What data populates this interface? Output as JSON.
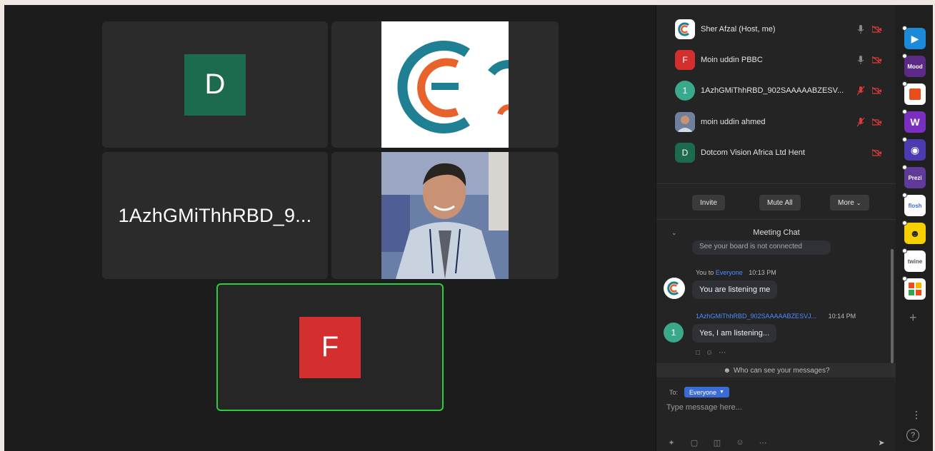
{
  "tiles": {
    "d_initial": "D",
    "tile3_name": "1AzhGMiThhRBD_9...",
    "f_initial": "F"
  },
  "participants": [
    {
      "name": "Sher Afzal (Host, me)",
      "initial": "",
      "color": "#ffffff"
    },
    {
      "name": "Moin uddin PBBC",
      "initial": "F",
      "color": "#d32f2f"
    },
    {
      "name": "1AzhGMiThhRBD_902SAAAAABZESV...",
      "initial": "1",
      "color": "#3aa88a"
    },
    {
      "name": "moin uddin ahmed",
      "initial": "",
      "color": "#888888"
    },
    {
      "name": "Dotcom Vision Africa Ltd Hent",
      "initial": "D",
      "color": "#1d6b4f"
    }
  ],
  "panel_buttons": {
    "invite": "Invite",
    "mute_all": "Mute All",
    "more": "More"
  },
  "chat": {
    "title": "Meeting Chat",
    "partial_msg": "See your board is not connected",
    "msg1": {
      "from": "You to",
      "to": "Everyone",
      "time": "10:13 PM",
      "text": "You are listening me"
    },
    "msg2": {
      "from": "1AzhGMiThhRBD_902SAAAAABZESVJ...",
      "time": "10:14 PM",
      "text": "Yes, I am listening...",
      "initial": "1"
    },
    "who_can_see": "Who can see your messages?",
    "to_label": "To:",
    "to_value": "Everyone",
    "placeholder": "Type message here..."
  },
  "apps": [
    {
      "label": "",
      "color": "#1a8ad9"
    },
    {
      "label": "Mood",
      "color": "#5b2a86"
    },
    {
      "label": "",
      "color": "#ffffff"
    },
    {
      "label": "W",
      "color": "#7b2fbf"
    },
    {
      "label": "",
      "color": "#4b3bb0"
    },
    {
      "label": "Prezi",
      "color": "#5f3a9a"
    },
    {
      "label": "flosh",
      "color": "#ffffff"
    },
    {
      "label": "",
      "color": "#f5d000"
    },
    {
      "label": "twine",
      "color": "#ffffff"
    },
    {
      "label": "",
      "color": "#ffffff"
    }
  ],
  "colors": {
    "accent": "#2ecc40",
    "chat_link": "#4a8cff",
    "pill": "#3b6bd9"
  }
}
